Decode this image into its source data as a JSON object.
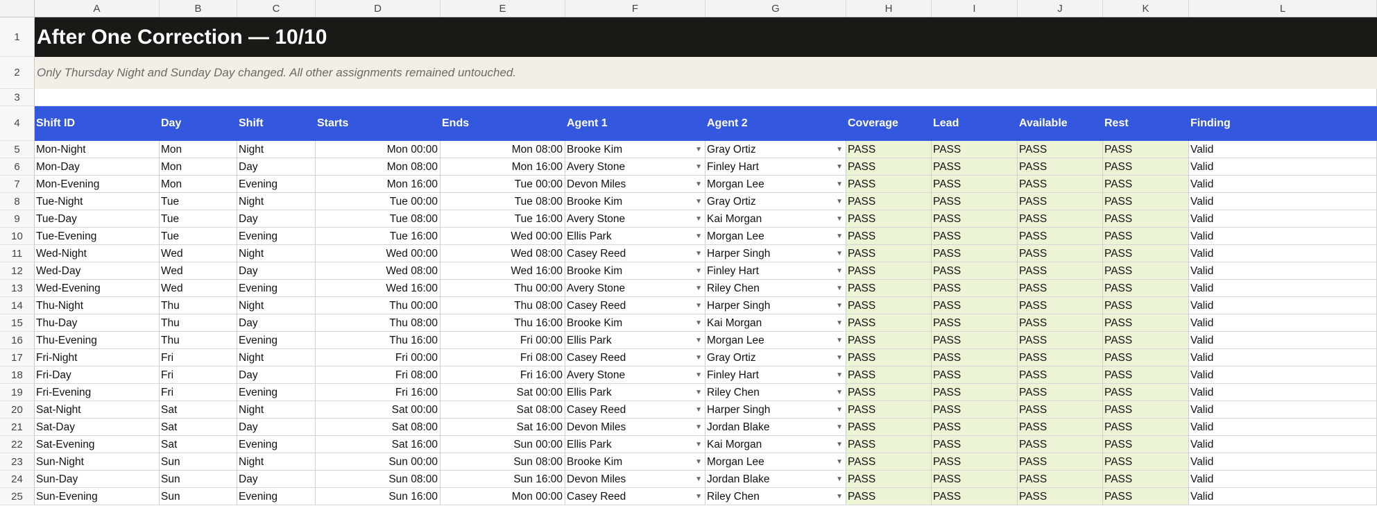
{
  "columns": [
    "A",
    "B",
    "C",
    "D",
    "E",
    "F",
    "G",
    "H",
    "I",
    "J",
    "K",
    "L"
  ],
  "row_numbers": [
    "1",
    "2",
    "3",
    "4",
    "5",
    "6",
    "7",
    "8",
    "9",
    "10",
    "11",
    "12",
    "13",
    "14",
    "15",
    "16",
    "17",
    "18",
    "19",
    "20",
    "21",
    "22",
    "23",
    "24",
    "25"
  ],
  "title": "After One Correction — 10/10",
  "subtitle": "Only Thursday Night and Sunday Day changed. All other assignments remained untouched.",
  "headers": [
    "Shift ID",
    "Day",
    "Shift",
    "Starts",
    "Ends",
    "Agent 1",
    "Agent 2",
    "Coverage",
    "Lead",
    "Available",
    "Rest",
    "Finding"
  ],
  "icons": {
    "dropdown": "dropdown-caret-icon"
  },
  "colors": {
    "title_bg": "#191916",
    "subtitle_bg": "#f2f0e6",
    "header_bg": "#3358dd",
    "pass_bg": "#ebf4d4"
  },
  "rows": [
    [
      "Mon-Night",
      "Mon",
      "Night",
      "Mon 00:00",
      "Mon 08:00",
      "Brooke Kim",
      "Gray Ortiz",
      "PASS",
      "PASS",
      "PASS",
      "PASS",
      "Valid"
    ],
    [
      "Mon-Day",
      "Mon",
      "Day",
      "Mon 08:00",
      "Mon 16:00",
      "Avery Stone",
      "Finley Hart",
      "PASS",
      "PASS",
      "PASS",
      "PASS",
      "Valid"
    ],
    [
      "Mon-Evening",
      "Mon",
      "Evening",
      "Mon 16:00",
      "Tue 00:00",
      "Devon Miles",
      "Morgan Lee",
      "PASS",
      "PASS",
      "PASS",
      "PASS",
      "Valid"
    ],
    [
      "Tue-Night",
      "Tue",
      "Night",
      "Tue 00:00",
      "Tue 08:00",
      "Brooke Kim",
      "Gray Ortiz",
      "PASS",
      "PASS",
      "PASS",
      "PASS",
      "Valid"
    ],
    [
      "Tue-Day",
      "Tue",
      "Day",
      "Tue 08:00",
      "Tue 16:00",
      "Avery Stone",
      "Kai Morgan",
      "PASS",
      "PASS",
      "PASS",
      "PASS",
      "Valid"
    ],
    [
      "Tue-Evening",
      "Tue",
      "Evening",
      "Tue 16:00",
      "Wed 00:00",
      "Ellis Park",
      "Morgan Lee",
      "PASS",
      "PASS",
      "PASS",
      "PASS",
      "Valid"
    ],
    [
      "Wed-Night",
      "Wed",
      "Night",
      "Wed 00:00",
      "Wed 08:00",
      "Casey Reed",
      "Harper Singh",
      "PASS",
      "PASS",
      "PASS",
      "PASS",
      "Valid"
    ],
    [
      "Wed-Day",
      "Wed",
      "Day",
      "Wed 08:00",
      "Wed 16:00",
      "Brooke Kim",
      "Finley Hart",
      "PASS",
      "PASS",
      "PASS",
      "PASS",
      "Valid"
    ],
    [
      "Wed-Evening",
      "Wed",
      "Evening",
      "Wed 16:00",
      "Thu 00:00",
      "Avery Stone",
      "Riley Chen",
      "PASS",
      "PASS",
      "PASS",
      "PASS",
      "Valid"
    ],
    [
      "Thu-Night",
      "Thu",
      "Night",
      "Thu 00:00",
      "Thu 08:00",
      "Casey Reed",
      "Harper Singh",
      "PASS",
      "PASS",
      "PASS",
      "PASS",
      "Valid"
    ],
    [
      "Thu-Day",
      "Thu",
      "Day",
      "Thu 08:00",
      "Thu 16:00",
      "Brooke Kim",
      "Kai Morgan",
      "PASS",
      "PASS",
      "PASS",
      "PASS",
      "Valid"
    ],
    [
      "Thu-Evening",
      "Thu",
      "Evening",
      "Thu 16:00",
      "Fri 00:00",
      "Ellis Park",
      "Morgan Lee",
      "PASS",
      "PASS",
      "PASS",
      "PASS",
      "Valid"
    ],
    [
      "Fri-Night",
      "Fri",
      "Night",
      "Fri 00:00",
      "Fri 08:00",
      "Casey Reed",
      "Gray Ortiz",
      "PASS",
      "PASS",
      "PASS",
      "PASS",
      "Valid"
    ],
    [
      "Fri-Day",
      "Fri",
      "Day",
      "Fri 08:00",
      "Fri 16:00",
      "Avery Stone",
      "Finley Hart",
      "PASS",
      "PASS",
      "PASS",
      "PASS",
      "Valid"
    ],
    [
      "Fri-Evening",
      "Fri",
      "Evening",
      "Fri 16:00",
      "Sat 00:00",
      "Ellis Park",
      "Riley Chen",
      "PASS",
      "PASS",
      "PASS",
      "PASS",
      "Valid"
    ],
    [
      "Sat-Night",
      "Sat",
      "Night",
      "Sat 00:00",
      "Sat 08:00",
      "Casey Reed",
      "Harper Singh",
      "PASS",
      "PASS",
      "PASS",
      "PASS",
      "Valid"
    ],
    [
      "Sat-Day",
      "Sat",
      "Day",
      "Sat 08:00",
      "Sat 16:00",
      "Devon Miles",
      "Jordan Blake",
      "PASS",
      "PASS",
      "PASS",
      "PASS",
      "Valid"
    ],
    [
      "Sat-Evening",
      "Sat",
      "Evening",
      "Sat 16:00",
      "Sun 00:00",
      "Ellis Park",
      "Kai Morgan",
      "PASS",
      "PASS",
      "PASS",
      "PASS",
      "Valid"
    ],
    [
      "Sun-Night",
      "Sun",
      "Night",
      "Sun 00:00",
      "Sun 08:00",
      "Brooke Kim",
      "Morgan Lee",
      "PASS",
      "PASS",
      "PASS",
      "PASS",
      "Valid"
    ],
    [
      "Sun-Day",
      "Sun",
      "Day",
      "Sun 08:00",
      "Sun 16:00",
      "Devon Miles",
      "Jordan Blake",
      "PASS",
      "PASS",
      "PASS",
      "PASS",
      "Valid"
    ],
    [
      "Sun-Evening",
      "Sun",
      "Evening",
      "Sun 16:00",
      "Mon 00:00",
      "Casey Reed",
      "Riley Chen",
      "PASS",
      "PASS",
      "PASS",
      "PASS",
      "Valid"
    ]
  ]
}
